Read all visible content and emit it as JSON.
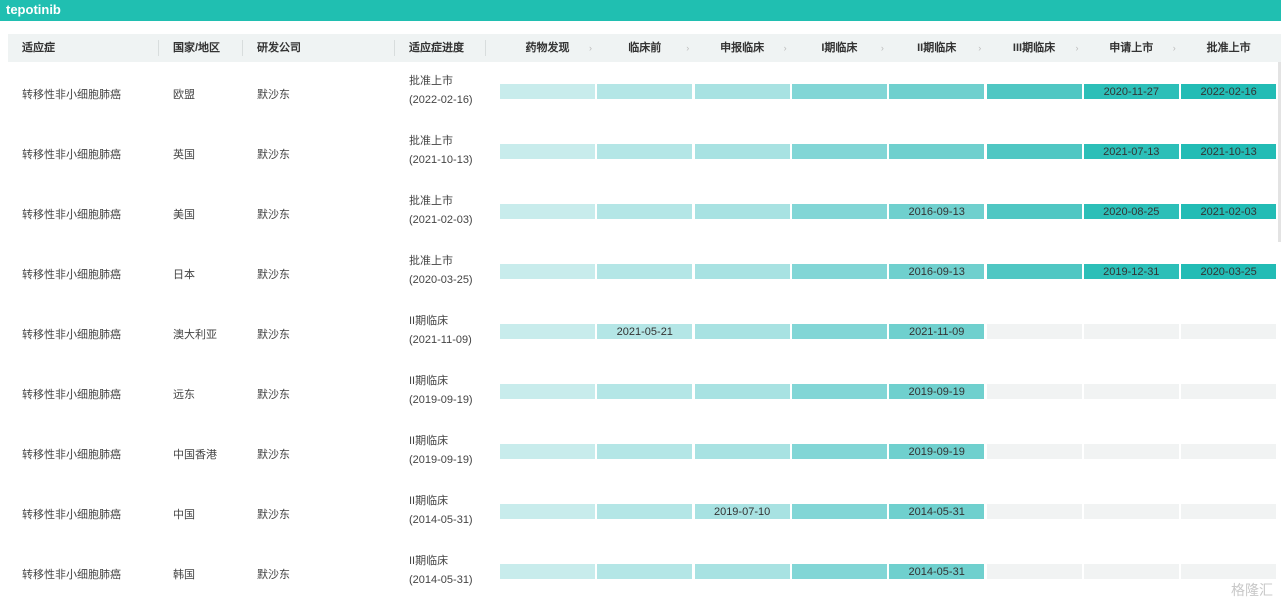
{
  "title": "tepotinib",
  "headers": {
    "indication": "适应症",
    "region": "国家/地区",
    "company": "研发公司",
    "progress": "适应症进度",
    "stages": [
      "药物发现",
      "临床前",
      "申报临床",
      "I期临床",
      "II期临床",
      "III期临床",
      "申请上市",
      "批准上市"
    ]
  },
  "colors": {
    "header_bar": "#20bfb1",
    "stage_fill": [
      "#c8ecec",
      "#b4e6e6",
      "#a8e2e2",
      "#82d6d6",
      "#6fd0ce",
      "#4fc7c3",
      "#2cbfb8",
      "#22bcb5"
    ],
    "empty": "#f1f3f3"
  },
  "rows": [
    {
      "indication": "转移性非小细胞肺癌",
      "region": "欧盟",
      "company": "默沙东",
      "status": "批准上市",
      "status_date": "(2022-02-16)",
      "reached": 8,
      "dates": [
        "",
        "",
        "",
        "",
        "",
        "",
        "2020-11-27",
        "2022-02-16"
      ]
    },
    {
      "indication": "转移性非小细胞肺癌",
      "region": "英国",
      "company": "默沙东",
      "status": "批准上市",
      "status_date": "(2021-10-13)",
      "reached": 8,
      "dates": [
        "",
        "",
        "",
        "",
        "",
        "",
        "2021-07-13",
        "2021-10-13"
      ]
    },
    {
      "indication": "转移性非小细胞肺癌",
      "region": "美国",
      "company": "默沙东",
      "status": "批准上市",
      "status_date": "(2021-02-03)",
      "reached": 8,
      "dates": [
        "",
        "",
        "",
        "",
        "2016-09-13",
        "",
        "2020-08-25",
        "2021-02-03"
      ]
    },
    {
      "indication": "转移性非小细胞肺癌",
      "region": "日本",
      "company": "默沙东",
      "status": "批准上市",
      "status_date": "(2020-03-25)",
      "reached": 8,
      "dates": [
        "",
        "",
        "",
        "",
        "2016-09-13",
        "",
        "2019-12-31",
        "2020-03-25"
      ]
    },
    {
      "indication": "转移性非小细胞肺癌",
      "region": "澳大利亚",
      "company": "默沙东",
      "status": "II期临床",
      "status_date": "(2021-11-09)",
      "reached": 5,
      "dates": [
        "",
        "2021-05-21",
        "",
        "",
        "2021-11-09",
        "",
        "",
        ""
      ]
    },
    {
      "indication": "转移性非小细胞肺癌",
      "region": "远东",
      "company": "默沙东",
      "status": "II期临床",
      "status_date": "(2019-09-19)",
      "reached": 5,
      "dates": [
        "",
        "",
        "",
        "",
        "2019-09-19",
        "",
        "",
        ""
      ]
    },
    {
      "indication": "转移性非小细胞肺癌",
      "region": "中国香港",
      "company": "默沙东",
      "status": "II期临床",
      "status_date": "(2019-09-19)",
      "reached": 5,
      "dates": [
        "",
        "",
        "",
        "",
        "2019-09-19",
        "",
        "",
        ""
      ]
    },
    {
      "indication": "转移性非小细胞肺癌",
      "region": "中国",
      "company": "默沙东",
      "status": "II期临床",
      "status_date": "(2014-05-31)",
      "reached": 5,
      "dates": [
        "",
        "",
        "2019-07-10",
        "",
        "2014-05-31",
        "",
        "",
        ""
      ]
    },
    {
      "indication": "转移性非小细胞肺癌",
      "region": "韩国",
      "company": "默沙东",
      "status": "II期临床",
      "status_date": "(2014-05-31)",
      "reached": 5,
      "dates": [
        "",
        "",
        "",
        "",
        "2014-05-31",
        "",
        "",
        ""
      ]
    }
  ],
  "watermark": "格隆汇"
}
